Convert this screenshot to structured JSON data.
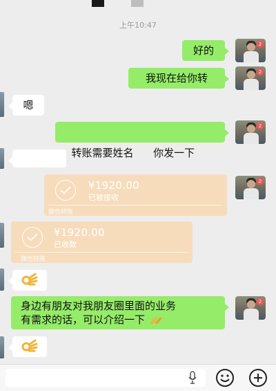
{
  "status": {
    "time": "上午10:47"
  },
  "messages": [
    {
      "side": "right",
      "type": "text",
      "text": "好的"
    },
    {
      "side": "right",
      "type": "text",
      "text": "我现在给你转"
    },
    {
      "side": "left",
      "type": "text",
      "text": "嗯"
    },
    {
      "side": "right",
      "type": "text",
      "text": "转账需要姓名      你发一下"
    },
    {
      "side": "left",
      "type": "text",
      "text": ""
    },
    {
      "side": "right",
      "type": "transfer",
      "amount": "¥1920.00",
      "status": "已被接收",
      "footer": "微信转账"
    },
    {
      "side": "left",
      "type": "transfer",
      "amount": "¥1920.00",
      "status": "已收款",
      "footer": "微信转账"
    },
    {
      "side": "left",
      "type": "emoji",
      "icon": "ok-hand-icon"
    },
    {
      "side": "right",
      "type": "text",
      "line1": "身边有朋友对我朋友圈里面的业务",
      "line2": "有需求的话，可以介绍一下",
      "icon": "clapping-hands-icon"
    },
    {
      "side": "left",
      "type": "emoji",
      "icon": "ok-hand-icon"
    }
  ],
  "avatar": {
    "badge": "2"
  },
  "input_bar": {
    "icons": [
      "microphone-icon",
      "emoji-icon",
      "plus-icon"
    ]
  },
  "colors": {
    "green_bubble": "#95ec69",
    "transfer": "#f7dcbc",
    "background": "#ededed"
  }
}
